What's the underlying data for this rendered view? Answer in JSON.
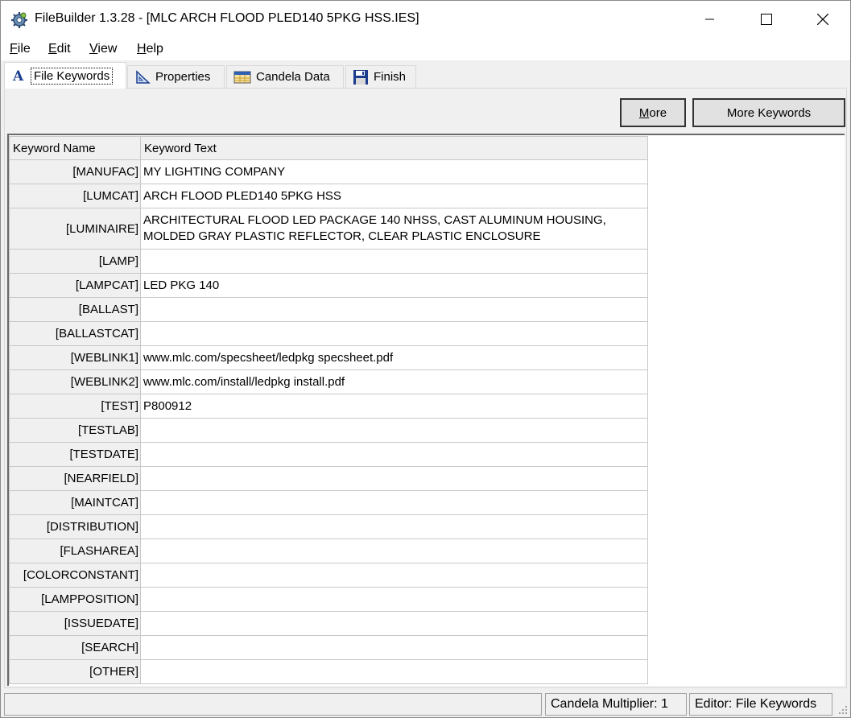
{
  "window": {
    "app_title": "FileBuilder 1.3.28 - [MLC ARCH FLOOD PLED140 5PKG HSS.IES]",
    "minimize_icon": "minimize-icon",
    "maximize_icon": "maximize-icon",
    "close_icon": "close-icon"
  },
  "menu": {
    "items": [
      {
        "label": "File"
      },
      {
        "label": "Edit"
      },
      {
        "label": "View"
      },
      {
        "label": "Help"
      }
    ]
  },
  "tabs": [
    {
      "label": "File Keywords",
      "icon": "letter-a-icon",
      "active": true
    },
    {
      "label": "Properties",
      "icon": "triangle-ruler-icon",
      "active": false
    },
    {
      "label": "Candela Data",
      "icon": "table-icon",
      "active": false
    },
    {
      "label": "Finish",
      "icon": "floppy-disk-icon",
      "active": false
    }
  ],
  "toolbar": {
    "more_label": "More",
    "more_keywords_label": "More Keywords"
  },
  "grid": {
    "columns": [
      "Keyword Name",
      "Keyword Text"
    ],
    "rows": [
      {
        "name": "[MANUFAC]",
        "text": "MY LIGHTING COMPANY"
      },
      {
        "name": "[LUMCAT]",
        "text": "ARCH FLOOD PLED140 5PKG HSS"
      },
      {
        "name": "[LUMINAIRE]",
        "text": "ARCHITECTURAL FLOOD LED PACKAGE 140 NHSS, CAST ALUMINUM HOUSING,\nMOLDED GRAY PLASTIC REFLECTOR, CLEAR PLASTIC ENCLOSURE"
      },
      {
        "name": "[LAMP]",
        "text": ""
      },
      {
        "name": "[LAMPCAT]",
        "text": "LED PKG 140"
      },
      {
        "name": "[BALLAST]",
        "text": ""
      },
      {
        "name": "[BALLASTCAT]",
        "text": ""
      },
      {
        "name": "[WEBLINK1]",
        "text": "www.mlc.com/specsheet/ledpkg specsheet.pdf"
      },
      {
        "name": "[WEBLINK2]",
        "text": "www.mlc.com/install/ledpkg install.pdf"
      },
      {
        "name": "[TEST]",
        "text": "P800912"
      },
      {
        "name": "[TESTLAB]",
        "text": ""
      },
      {
        "name": "[TESTDATE]",
        "text": ""
      },
      {
        "name": "[NEARFIELD]",
        "text": ""
      },
      {
        "name": "[MAINTCAT]",
        "text": ""
      },
      {
        "name": "[DISTRIBUTION]",
        "text": ""
      },
      {
        "name": "[FLASHAREA]",
        "text": ""
      },
      {
        "name": "[COLORCONSTANT]",
        "text": ""
      },
      {
        "name": "[LAMPPOSITION]",
        "text": ""
      },
      {
        "name": "[ISSUEDATE]",
        "text": ""
      },
      {
        "name": "[SEARCH]",
        "text": ""
      },
      {
        "name": "[OTHER]",
        "text": ""
      }
    ]
  },
  "status": {
    "pane0": "",
    "candela_multiplier": "Candela Multiplier: 1",
    "editor": "Editor: File Keywords"
  }
}
